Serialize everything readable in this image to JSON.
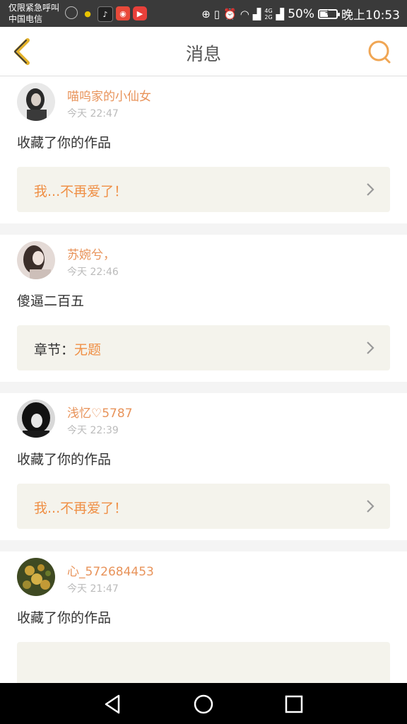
{
  "status_bar": {
    "carrier_line1": "仅限紧急呼叫",
    "carrier_line2": "中国电信",
    "network_top": "4G",
    "network_bottom": "2G",
    "battery": "50%",
    "battery_level": 0.5,
    "time": "晚上10:53"
  },
  "header": {
    "title": "消息",
    "back_icon": "chevron-left-icon",
    "search_icon": "search-icon",
    "accent_color": "#e8a13c"
  },
  "messages": [
    {
      "username": "喵呜家的小仙女",
      "time": "今天 22:47",
      "content": "收藏了你的作品",
      "ref_prefix": "",
      "ref_title": "我...不再爱了！"
    },
    {
      "username": "苏婉兮，",
      "time": "今天 22:46",
      "content": "傻逼二百五",
      "ref_prefix": "章节：",
      "ref_title": "无题"
    },
    {
      "username": "浅忆♡5787",
      "time": "今天 22:39",
      "content": "收藏了你的作品",
      "ref_prefix": "",
      "ref_title": "我...不再爱了！"
    },
    {
      "username": "心_572684453",
      "time": "今天 21:47",
      "content": "收藏了你的作品",
      "ref_prefix": "",
      "ref_title": ""
    }
  ],
  "colors": {
    "username": "#e8935a",
    "highlight": "#ef8f45",
    "card_bg": "#f4f3ec"
  }
}
